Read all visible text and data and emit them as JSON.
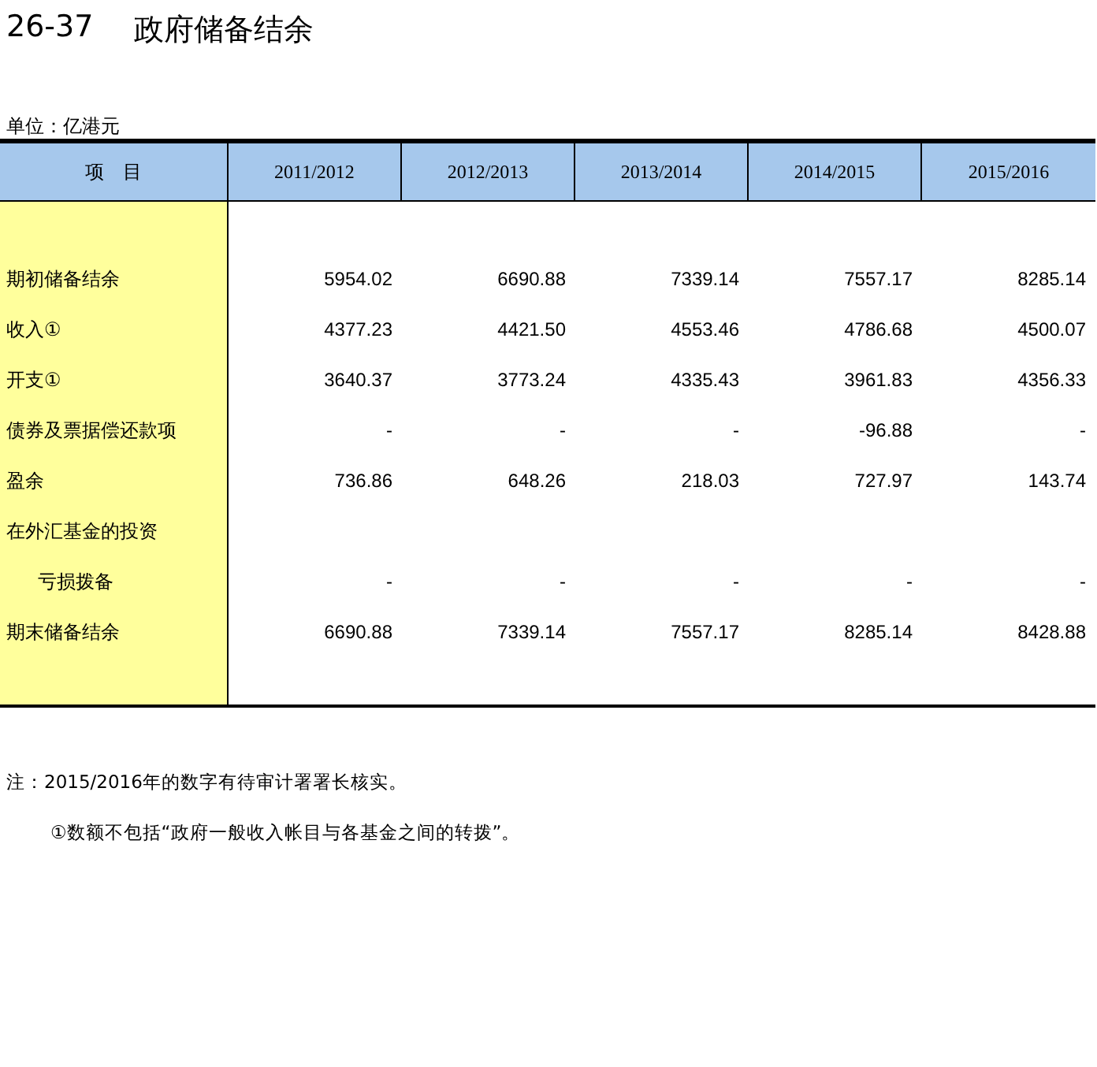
{
  "title": {
    "number": "26-37",
    "text": "政府储备结余"
  },
  "unit": "单位：亿港元",
  "table": {
    "columns": [
      "项　目",
      "2011/2012",
      "2012/2013",
      "2013/2014",
      "2014/2015",
      "2015/2016"
    ],
    "rows": [
      {
        "label": "期初储备结余",
        "values": [
          "5954.02",
          "6690.88",
          "7339.14",
          "7557.17",
          "8285.14"
        ]
      },
      {
        "label": "收入①",
        "values": [
          "4377.23",
          "4421.50",
          "4553.46",
          "4786.68",
          "4500.07"
        ]
      },
      {
        "label": "开支①",
        "values": [
          "3640.37",
          "3773.24",
          "4335.43",
          "3961.83",
          "4356.33"
        ]
      },
      {
        "label": "债券及票据偿还款项",
        "values": [
          "-",
          "-",
          "-",
          "-96.88",
          "-"
        ]
      },
      {
        "label": "盈余",
        "values": [
          "736.86",
          "648.26",
          "218.03",
          "727.97",
          "143.74"
        ]
      },
      {
        "label": "在外汇基金的投资",
        "children": [
          {
            "label": "亏损拨备",
            "values": [
              "-",
              "-",
              "-",
              "-",
              "-"
            ]
          }
        ]
      },
      {
        "label": "期末储备结余",
        "values": [
          "6690.88",
          "7339.14",
          "7557.17",
          "8285.14",
          "8428.88"
        ]
      }
    ]
  },
  "notes": [
    "注：2015/2016年的数字有待审计署署长核实。",
    "①数额不包括“政府一般收入帐目与各基金之间的转拨”。"
  ]
}
